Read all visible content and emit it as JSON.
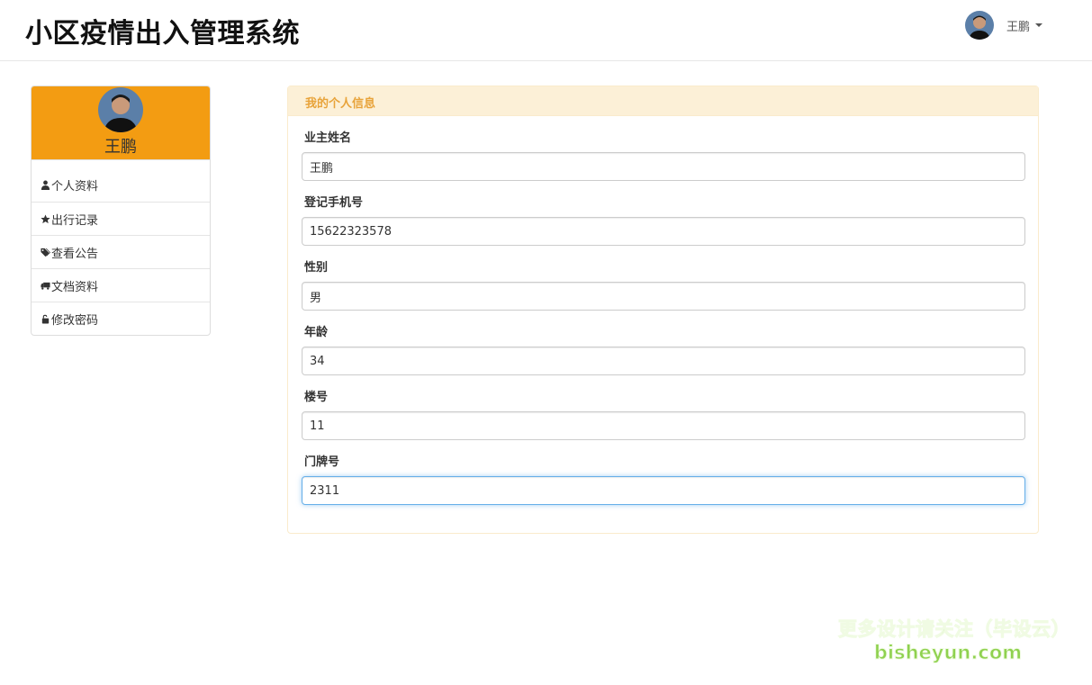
{
  "header": {
    "site_title": "小区疫情出入管理系统",
    "user_name": "王鹏"
  },
  "sidebar": {
    "profile_name": "王鹏",
    "accent_color": "#f39c12",
    "items": [
      {
        "label": "个人资料",
        "icon": "user-icon"
      },
      {
        "label": "出行记录",
        "icon": "star-icon"
      },
      {
        "label": "查看公告",
        "icon": "tags-icon"
      },
      {
        "label": "文档资料",
        "icon": "truck-icon"
      },
      {
        "label": "修改密码",
        "icon": "unlock-icon"
      }
    ]
  },
  "panel": {
    "title": "我的个人信息",
    "fields": [
      {
        "label": "业主姓名",
        "value": "王鹏"
      },
      {
        "label": "登记手机号",
        "value": "15622323578"
      },
      {
        "label": "性别",
        "value": "男"
      },
      {
        "label": "年龄",
        "value": "34"
      },
      {
        "label": "楼号",
        "value": "11"
      },
      {
        "label": "门牌号",
        "value": "2311"
      }
    ]
  },
  "watermark": {
    "line1": "更多设计请关注（毕设云）",
    "line2": "bisheyun.com"
  }
}
